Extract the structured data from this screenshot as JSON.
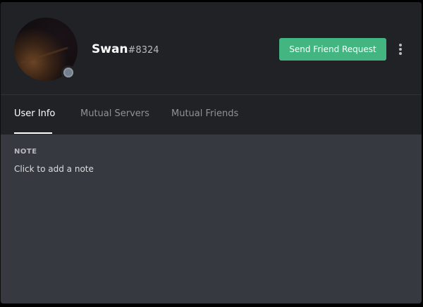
{
  "profile": {
    "username": "Swan",
    "discriminator": "#8324",
    "avatar_icon": "user-avatar-photo",
    "status": "offline",
    "status_color": "#747f8d"
  },
  "actions": {
    "send_friend_request_label": "Send Friend Request",
    "send_friend_request_color": "#43b581",
    "more_icon": "kebab-menu-icon"
  },
  "tabs": [
    {
      "label": "User Info",
      "active": true
    },
    {
      "label": "Mutual Servers",
      "active": false
    },
    {
      "label": "Mutual Friends",
      "active": false
    }
  ],
  "note": {
    "label": "NOTE",
    "placeholder": "Click to add a note"
  }
}
